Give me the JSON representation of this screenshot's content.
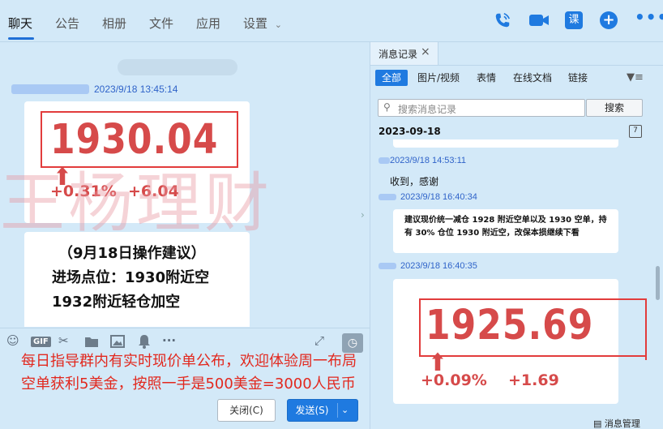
{
  "nav": {
    "tabs": [
      {
        "label": "聊天"
      },
      {
        "label": "公告"
      },
      {
        "label": "相册"
      },
      {
        "label": "文件"
      },
      {
        "label": "应用"
      },
      {
        "label": "设置"
      }
    ],
    "course_icon_label": "课",
    "accent_color": "#1f7ae0"
  },
  "chat": {
    "message1_time": "2023/9/18 13:45:14",
    "price": "1930.04",
    "change_pct": "+0.31%",
    "change_abs": "+6.04",
    "advice_line1": "（9月18日操作建议）",
    "advice_line2": "进场点位：1930附近空",
    "advice_line3": "1932附近轻仓加空",
    "watermark": "王杨理财"
  },
  "composer": {
    "overlay_text": "每日指导群内有实时现价单公布，欢迎体验周一布局空单获利5美金，按照一手是500美金=3000人民币",
    "close_label": "关闭(C)",
    "send_label": "发送(S)",
    "gif_label": "GIF"
  },
  "history": {
    "title": "消息记录",
    "filters": [
      {
        "label": "全部"
      },
      {
        "label": "图片/视频"
      },
      {
        "label": "表情"
      },
      {
        "label": "在线文档"
      },
      {
        "label": "链接"
      }
    ],
    "search_placeholder": "搜索消息记录",
    "search_button": "搜索",
    "date_header": "2023-09-18",
    "calendar_label": "7",
    "messages": [
      {
        "time": "2023/9/18 14:53:11",
        "text": "收到，感谢"
      },
      {
        "time": "2023/9/18 16:40:34",
        "text": "建议现价统一减仓 1928 附近空单以及 1930 空单，持有 30% 仓位 1930 附近空，改保本损继续下看"
      },
      {
        "time": "2023/9/18 16:40:35",
        "price": "1925.69",
        "change_pct": "+0.09%",
        "change_abs": "+1.69"
      }
    ],
    "manage_label": "消息管理"
  }
}
